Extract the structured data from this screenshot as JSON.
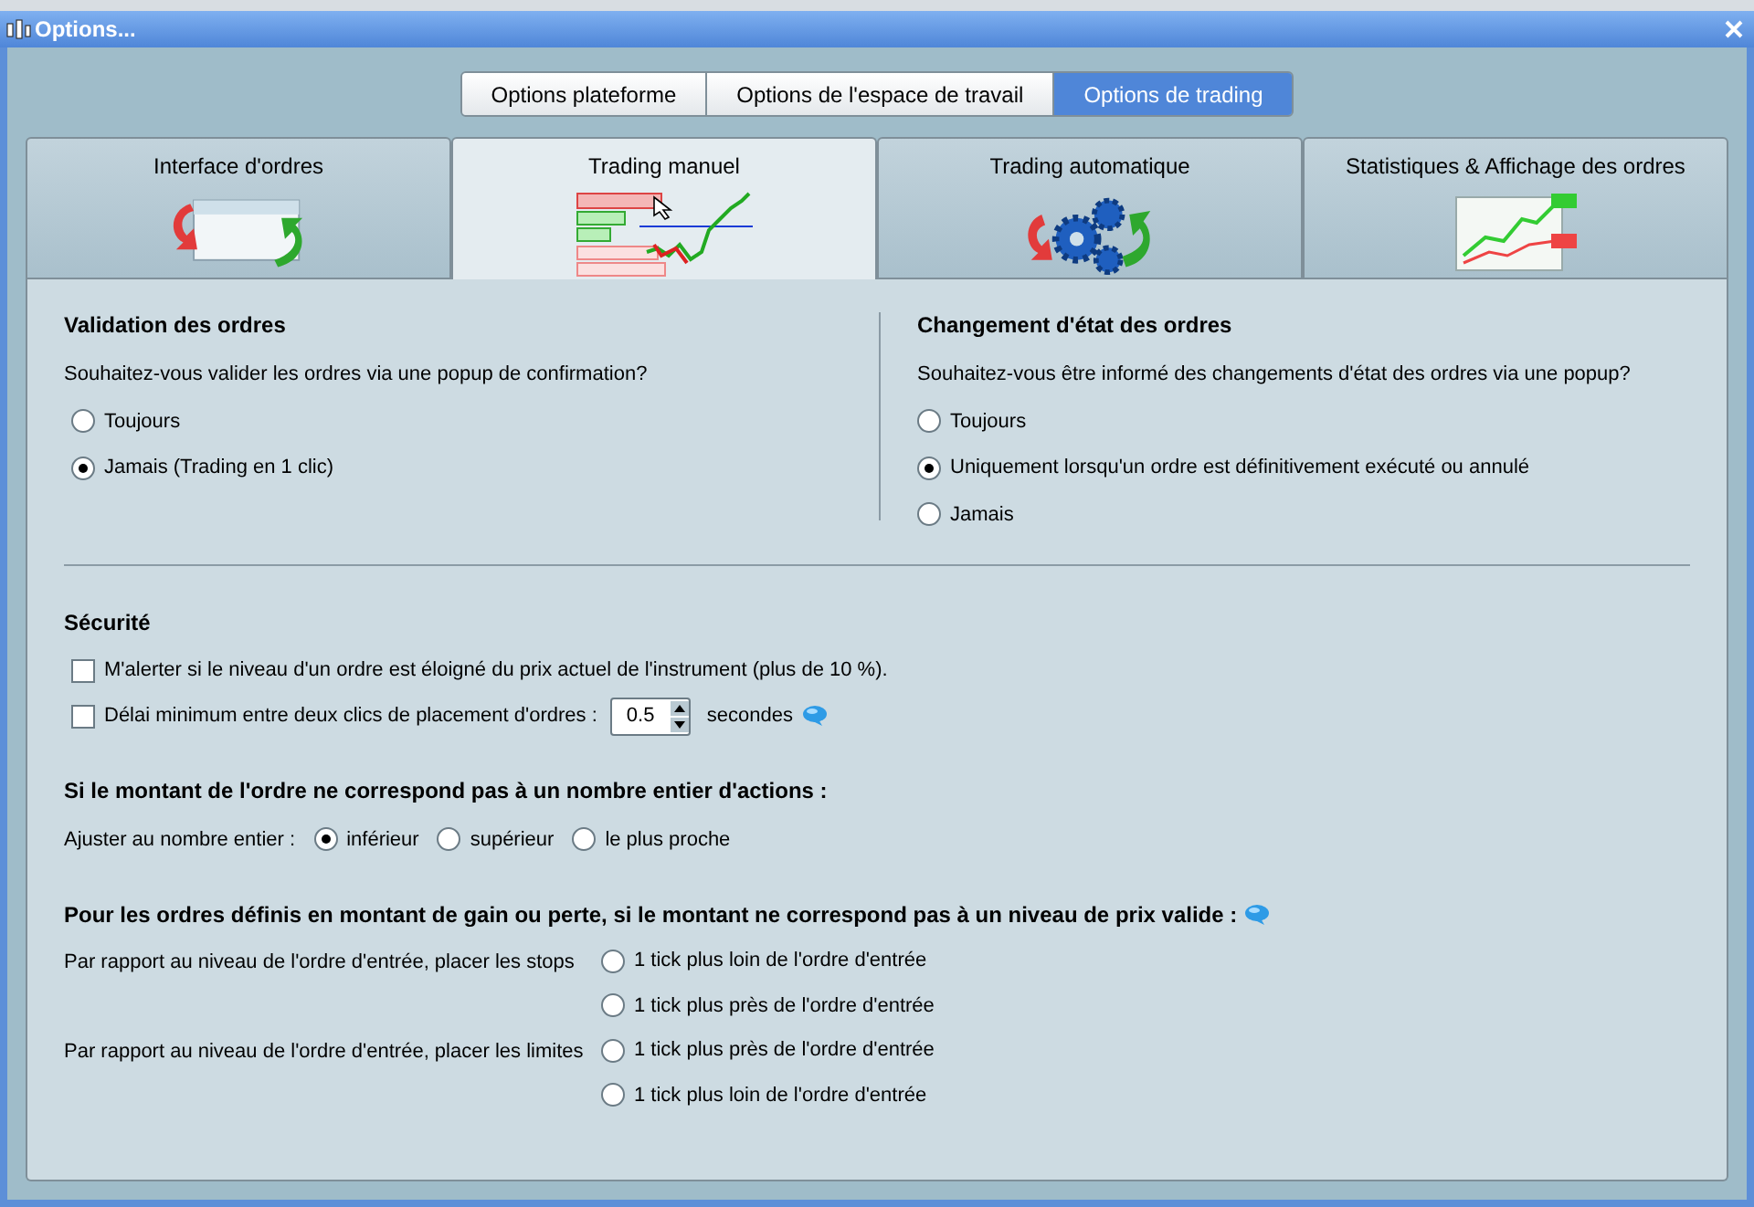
{
  "window": {
    "title": "Options..."
  },
  "top_tabs": [
    {
      "label": "Options plateforme",
      "selected": false
    },
    {
      "label": "Options de l'espace de travail",
      "selected": false
    },
    {
      "label": "Options de trading",
      "selected": true
    }
  ],
  "sub_tabs": [
    {
      "label": "Interface d'ordres",
      "selected": false,
      "kind": "interface"
    },
    {
      "label": "Trading manuel",
      "selected": true,
      "kind": "manual"
    },
    {
      "label": "Trading automatique",
      "selected": false,
      "kind": "auto"
    },
    {
      "label": "Statistiques & Affichage des ordres",
      "selected": false,
      "kind": "stats"
    }
  ],
  "validation": {
    "title": "Validation des ordres",
    "question": "Souhaitez-vous valider les ordres via une popup de confirmation?",
    "options": [
      {
        "label": "Toujours",
        "selected": false
      },
      {
        "label": "Jamais (Trading en 1 clic)",
        "selected": true
      }
    ]
  },
  "state_change": {
    "title": "Changement d'état des ordres",
    "question": "Souhaitez-vous être informé des changements d'état des ordres via une popup?",
    "options": [
      {
        "label": "Toujours",
        "selected": false
      },
      {
        "label": "Uniquement lorsqu'un ordre est définitivement exécuté ou annulé",
        "selected": true
      },
      {
        "label": "Jamais",
        "selected": false
      }
    ]
  },
  "security": {
    "title": "Sécurité",
    "alert": {
      "label": "M'alerter si le niveau d'un ordre est éloigné du prix actuel de l'instrument (plus de 10 %).",
      "checked": false
    },
    "delay": {
      "label": "Délai minimum entre deux clics de placement d'ordres :",
      "checked": false,
      "value": "0.5",
      "unit": "secondes"
    }
  },
  "rounding": {
    "title": "Si le montant de l'ordre ne correspond pas à un nombre entier d'actions :",
    "label": "Ajuster au nombre entier :",
    "options": [
      {
        "label": "inférieur",
        "selected": true
      },
      {
        "label": "supérieur",
        "selected": false
      },
      {
        "label": "le plus proche",
        "selected": false
      }
    ]
  },
  "price_levels": {
    "title": "Pour les ordres définis en montant de gain ou perte, si le montant ne correspond pas à un niveau de prix valide :",
    "groups": [
      {
        "label": "Par rapport au niveau de l'ordre d'entrée, placer les stops",
        "options": [
          {
            "label": "1 tick plus loin de l'ordre d'entrée",
            "selected": false
          },
          {
            "label": "1 tick plus près de l'ordre d'entrée",
            "selected": false
          }
        ]
      },
      {
        "label": "Par rapport au niveau de l'ordre d'entrée, placer les limites",
        "options": [
          {
            "label": "1 tick plus près de l'ordre d'entrée",
            "selected": false
          },
          {
            "label": "1 tick plus loin de l'ordre d'entrée",
            "selected": false
          }
        ]
      }
    ]
  }
}
